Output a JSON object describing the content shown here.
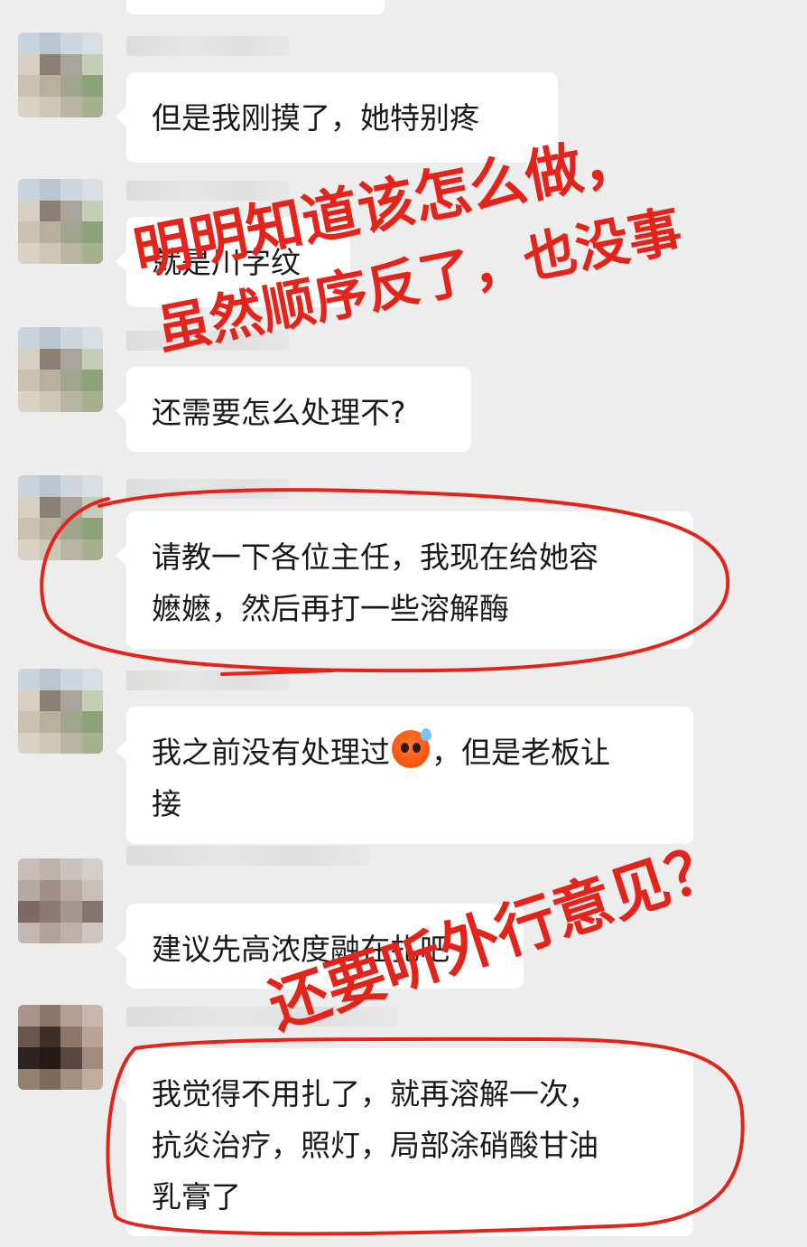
{
  "colors": {
    "chat_background": "#ededed",
    "bubble": "#ffffff",
    "text": "#191919",
    "annotation_red": "#e4231b"
  },
  "messages": [
    {
      "text": "但是我刚摸了，她特别疼"
    },
    {
      "text": "就是川字纹"
    },
    {
      "text": "还需要怎么处理不?"
    },
    {
      "text": "请教一下各位主任，我现在给她容\n嬷嬷，然后再打一些溶解酶"
    },
    {
      "text_before_emoji": "我之前没有处理过",
      "emoji": "flushed-sweat-emoji",
      "text_after_emoji": "，但是老板让\n接"
    },
    {
      "text": "建议先高浓度融在扎吧"
    },
    {
      "text": "我觉得不用扎了，就再溶解一次，\n抗炎治疗，照灯，局部涂硝酸甘油\n乳膏了"
    }
  ],
  "annotations": {
    "line1": "明明知道该怎么做，",
    "line2": "虽然顺序反了，也没事",
    "line3": "还要听外行意见？"
  }
}
